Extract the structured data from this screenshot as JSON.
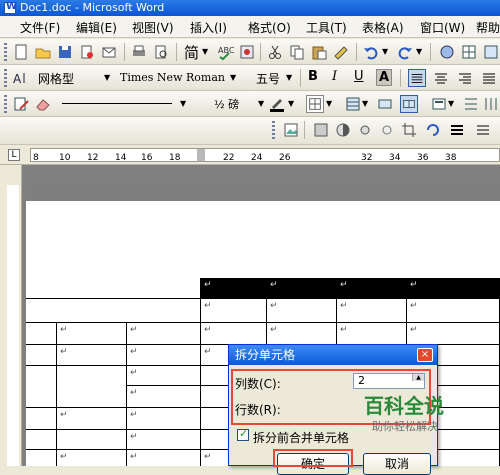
{
  "window": {
    "title": "Doc1.doc - Microsoft Word"
  },
  "menu": [
    "文件(F)",
    "编辑(E)",
    "视图(V)",
    "插入(I)",
    "格式(O)",
    "工具(T)",
    "表格(A)",
    "窗口(W)",
    "帮助"
  ],
  "toolbar_standard": {
    "font_combo": "简",
    "size_label": "五号"
  },
  "toolbar_format": {
    "style": "网格型",
    "font": "Times New Roman",
    "size": "五号",
    "bold": "B",
    "italic": "I",
    "underline": "U",
    "highlight": "A"
  },
  "toolbar_table": {
    "weight": "½ 磅"
  },
  "ruler": {
    "labels": [
      "8",
      "10",
      "12",
      "14",
      "16",
      "18",
      "22",
      "24",
      "26",
      "32",
      "34",
      "36",
      "38"
    ]
  },
  "cell_mark": "↵",
  "dialog": {
    "title": "拆分单元格",
    "close": "×",
    "columns_label": "列数(C):",
    "rows_label": "行数(R):",
    "columns_value": "2",
    "merge_label": "拆分前合并单元格",
    "ok": "确定",
    "cancel": "取消"
  },
  "watermark": {
    "main": "百科全说",
    "sub": "助你轻松解决"
  },
  "colors": {
    "accent": "#e8473a",
    "titlebar": "#0b55d6",
    "brand_green": "#2a8a3a"
  }
}
